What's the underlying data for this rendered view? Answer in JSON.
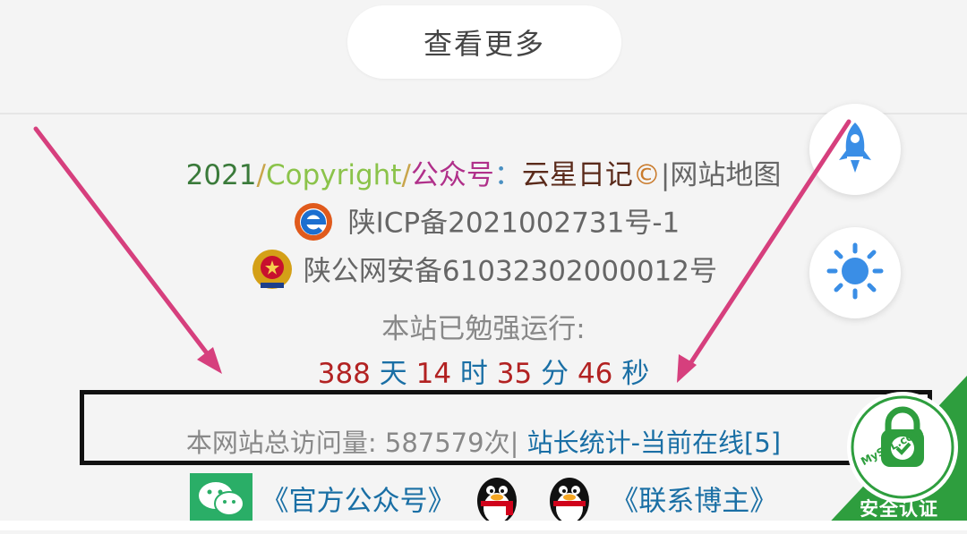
{
  "more_button": {
    "label": "查看更多"
  },
  "footer": {
    "copyright": {
      "year": "2021",
      "sep1": "/",
      "copyright_word": "Copyright",
      "sep2": "/",
      "gzh": "公众号",
      "colon": "：",
      "name": "云星日记",
      "copy_symbol": "©",
      "sitemap": "|网站地图"
    },
    "icp": "陕ICP备2021002731号-1",
    "police": "陕公网安备61032302000012号",
    "uptime_label": "本站已勉强运行:",
    "uptime": {
      "days": "388",
      "days_unit": "天",
      "hours": "14",
      "hours_unit": "时",
      "minutes": "35",
      "minutes_unit": "分",
      "seconds": "46",
      "seconds_unit": "秒"
    },
    "visits": {
      "label": "本网站总访问量: 587579次|",
      "stats_link": "站长统计",
      "online": "-当前在线[5]"
    },
    "links": {
      "official_account": "《官方公众号》",
      "contact": "《联系博主》"
    }
  },
  "ssl_badge": {
    "domain": "MySSL.com",
    "label": "安全认证"
  },
  "colors": {
    "accent_blue": "#1a6fa5",
    "time_red": "#b22222",
    "fab_blue": "#3a8ee6",
    "ssl_green": "#2e9e3e",
    "arrow_pink": "#d63f7d"
  },
  "icons": {
    "rocket": "rocket-icon",
    "sun": "sun-icon",
    "icp": "icp-e-icon",
    "police": "police-badge-icon",
    "wechat": "wechat-icon",
    "qq": "qq-penguin-icon",
    "lock": "lock-check-icon"
  }
}
